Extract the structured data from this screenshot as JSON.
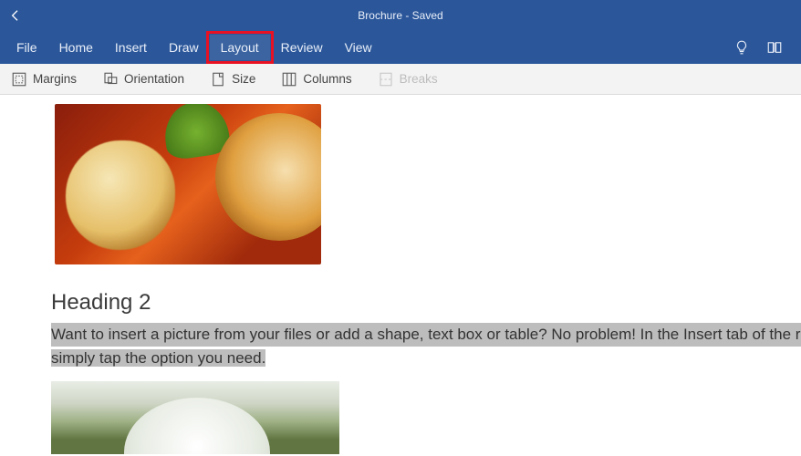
{
  "title": "Brochure - Saved",
  "tabs": {
    "file": "File",
    "home": "Home",
    "insert": "Insert",
    "draw": "Draw",
    "layout": "Layout",
    "review": "Review",
    "view": "View"
  },
  "active_tab": "layout",
  "ribbon": {
    "margins": "Margins",
    "orientation": "Orientation",
    "size": "Size",
    "columns": "Columns",
    "breaks": "Breaks"
  },
  "document": {
    "heading2": "Heading 2",
    "paragraph_line1": "Want to insert a picture from your files or add a shape, text box or table? No problem! In the Insert tab of the rib",
    "paragraph_line2": "simply tap the option you need."
  }
}
